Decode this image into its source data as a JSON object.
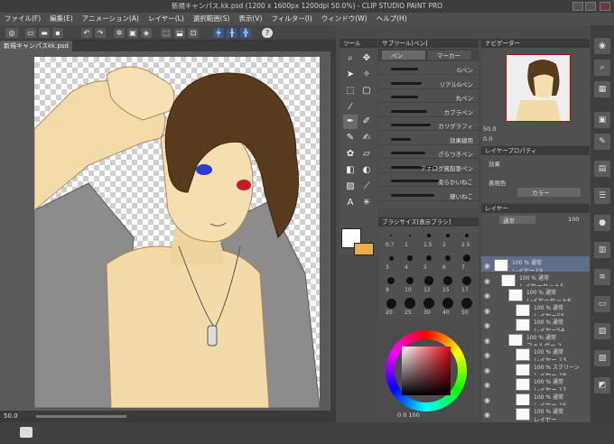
{
  "title": "新規キャンパス.kk.psd (1200 x 1600px 1200dpi 50.0%) - CLIP STUDIO PAINT PRO",
  "menu": [
    "ファイル(F)",
    "編集(E)",
    "アニメーション(A)",
    "レイヤー(L)",
    "選択範囲(S)",
    "表示(V)",
    "フィルター(I)",
    "ウィンドウ(W)",
    "ヘルプ(H)"
  ],
  "doc_tab": "新規キャンパスkk.psd",
  "status_zoom": "50.0",
  "panels": {
    "tool_tab": "ツール",
    "subtool_tab": "サブツール[ペン]",
    "subtool_pen": "ペン",
    "subtool_marker": "マーカー",
    "brushes": [
      "Gペン",
      "リアルGペン",
      "丸ペン",
      "カブラペン",
      "カリグラフィ",
      "効果線用",
      "ざらつきペン",
      "アナログ風鉛筆ペン",
      "柔らかいねこ",
      "硬いねこ"
    ],
    "brush_size_header": "ブラシサイズ[表示ブラシ]",
    "brush_sizes": [
      "0.7",
      "1",
      "1.5",
      "2",
      "2.5",
      "3",
      "4",
      "5",
      "6",
      "7",
      "8",
      "10",
      "12",
      "15",
      "17",
      "20",
      "25",
      "30",
      "40",
      "50"
    ],
    "color_values": "0  0  100",
    "navigator_tab": "ナビゲーター",
    "nav_zoom": "50.0",
    "nav_angle": "0.0",
    "property_tab": "レイヤープロパティ",
    "effect_label": "効果",
    "expression_color_label": "表現色",
    "expression_color_value": "カラー",
    "layer_tab": "レイヤー",
    "layer_mode": "通常",
    "layer_opacity": "100"
  },
  "layers": [
    {
      "l1": "100 % 通常",
      "l2": "レイヤー19",
      "indent": 0
    },
    {
      "l1": "100 % 通常",
      "l2": "レイヤーセット5",
      "indent": 1
    },
    {
      "l1": "100 % 通常",
      "l2": "レイヤーセット6",
      "indent": 2
    },
    {
      "l1": "100 % 通常",
      "l2": "レイヤー55",
      "indent": 3
    },
    {
      "l1": "100 % 通常",
      "l2": "レイヤー54",
      "indent": 3
    },
    {
      "l1": "100 % 通常",
      "l2": "フォルダー 2",
      "indent": 2
    },
    {
      "l1": "100 % 通常",
      "l2": "レイヤー 13",
      "indent": 3
    },
    {
      "l1": "100 % スクリーン",
      "l2": "レイヤー 18",
      "indent": 3
    },
    {
      "l1": "100 % 通常",
      "l2": "レイヤー 17",
      "indent": 3
    },
    {
      "l1": "100 % 通常",
      "l2": "レイヤー 16",
      "indent": 3
    },
    {
      "l1": "100 % 通常",
      "l2": "レイヤー",
      "indent": 3
    }
  ],
  "colors": {
    "accent": "#4a78b8",
    "main_color": "#ffffff",
    "sub_color": "#e8b04a",
    "hair": "#5a3a1c",
    "skin": "#f3dcab",
    "shirt": "#8e8e8e"
  }
}
